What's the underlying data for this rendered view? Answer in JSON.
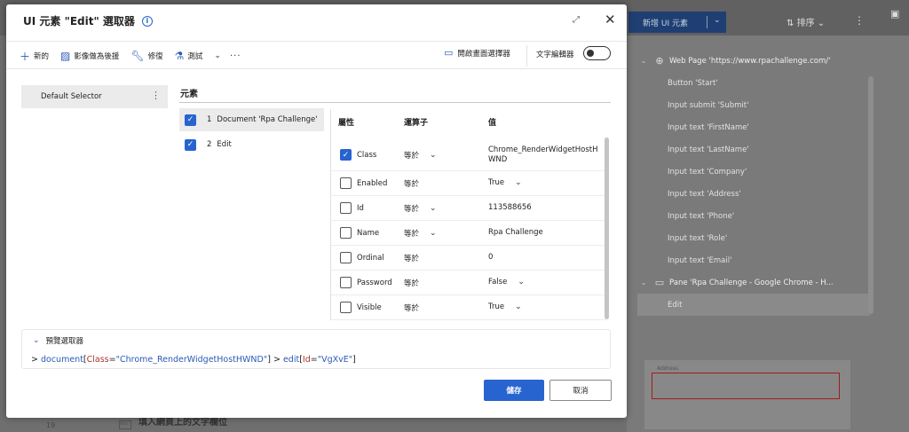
{
  "dialog": {
    "title": "UI 元素 \"Edit\" 選取器",
    "info_icon": "info-icon",
    "toolbar": {
      "new_label": "新的",
      "image_fallback_label": "影像做為後援",
      "repair_label": "修復",
      "test_label": "測試",
      "open_picker_label": "開啟畫面選擇器",
      "text_editor_label": "文字編輯器",
      "text_editor_on": false
    },
    "selectors": [
      {
        "label": "Default Selector"
      }
    ],
    "elements_title": "元素",
    "elements": [
      {
        "index": "1",
        "label": "Document 'Rpa Challenge'",
        "checked": true,
        "selected": true
      },
      {
        "index": "2",
        "label": "Edit",
        "checked": true,
        "selected": false
      }
    ],
    "attributes_header": {
      "name": "屬性",
      "operator": "運算子",
      "value": "值"
    },
    "attributes": [
      {
        "name": "Class",
        "checked": true,
        "operator": "等於",
        "op_dropdown": true,
        "value": "Chrome_RenderWidgetHostH WND",
        "value_dropdown": false
      },
      {
        "name": "Enabled",
        "checked": false,
        "operator": "等於",
        "op_dropdown": false,
        "value": "True",
        "value_dropdown": true
      },
      {
        "name": "Id",
        "checked": false,
        "operator": "等於",
        "op_dropdown": true,
        "value": "113588656",
        "value_dropdown": false
      },
      {
        "name": "Name",
        "checked": false,
        "operator": "等於",
        "op_dropdown": true,
        "value": "Rpa Challenge",
        "value_dropdown": false
      },
      {
        "name": "Ordinal",
        "checked": false,
        "operator": "等於",
        "op_dropdown": false,
        "value": "0",
        "value_dropdown": false
      },
      {
        "name": "Password",
        "checked": false,
        "operator": "等於",
        "op_dropdown": false,
        "value": "False",
        "value_dropdown": true
      },
      {
        "name": "Visible",
        "checked": false,
        "operator": "等於",
        "op_dropdown": false,
        "value": "True",
        "value_dropdown": true
      }
    ],
    "preview": {
      "title": "預覽選取器",
      "prefix": "> ",
      "part1_tag": "document",
      "part1_attr_open": "[",
      "part1_attr": "Class",
      "part1_eq": "=",
      "part1_val": "\"Chrome_RenderWidgetHostHWND\"",
      "part1_close": "]",
      "sep": " > ",
      "part2_tag": "edit",
      "part2_attr_open": "[",
      "part2_attr": "Id",
      "part2_eq": "=",
      "part2_val": "\"VgXvE\"",
      "part2_close": "]"
    },
    "save_label": "儲存",
    "cancel_label": "取消"
  },
  "background": {
    "add_ui_element_label": "新增 UI 元素",
    "sort_label": "排序",
    "tree": [
      {
        "label": "Web Page 'https://www.rpachallenge.com/'",
        "type": "parent",
        "icon": "globe-icon"
      },
      {
        "label": "Button 'Start'",
        "type": "child"
      },
      {
        "label": "Input submit 'Submit'",
        "type": "child"
      },
      {
        "label": "Input text 'FirstName'",
        "type": "child"
      },
      {
        "label": "Input text 'LastName'",
        "type": "child"
      },
      {
        "label": "Input text 'Company'",
        "type": "child"
      },
      {
        "label": "Input text 'Address'",
        "type": "child"
      },
      {
        "label": "Input text 'Phone'",
        "type": "child"
      },
      {
        "label": "Input text 'Role'",
        "type": "child"
      },
      {
        "label": "Input text 'Email'",
        "type": "child"
      },
      {
        "label": "Pane 'Rpa Challenge - Google Chrome - H...",
        "type": "parent",
        "icon": "window-icon"
      },
      {
        "label": "Edit",
        "type": "child",
        "selected": true
      }
    ],
    "preview_field_label": "Address",
    "step_number": "19",
    "step_title": "填入網頁上的文字欄位",
    "step_icon_text": "Abc"
  }
}
